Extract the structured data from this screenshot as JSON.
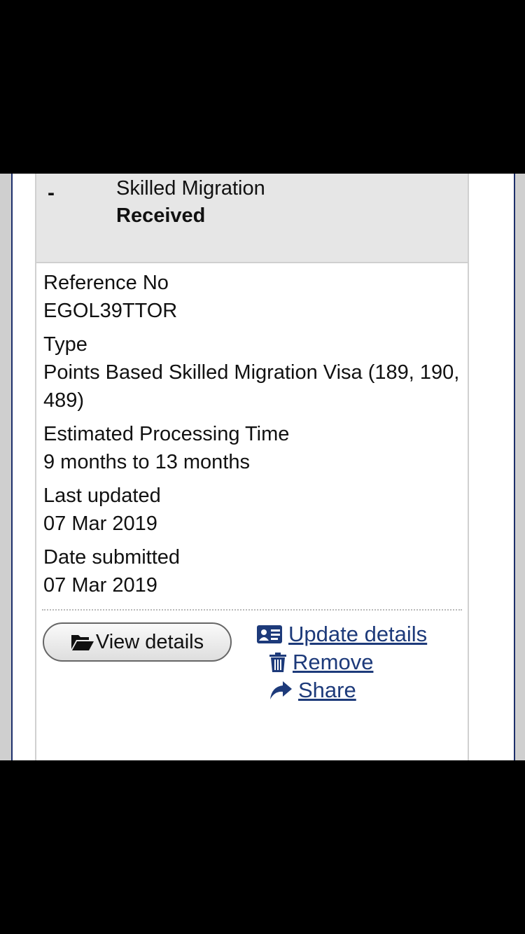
{
  "application": {
    "title": "Skilled Migration",
    "status": "Received",
    "collapse_symbol": "-"
  },
  "fields": [
    {
      "label": "Reference No",
      "value": "EGOL39TTOR"
    },
    {
      "label": "Type",
      "value": "Points Based Skilled Migration Visa (189, 190, 489)"
    },
    {
      "label": "Estimated Processing Time",
      "value": "9 months to 13 months"
    },
    {
      "label": "Last updated",
      "value": "07 Mar 2019"
    },
    {
      "label": "Date submitted",
      "value": "07 Mar 2019"
    }
  ],
  "actions": {
    "view_details": {
      "label": "View details",
      "icon": "folder-open-icon"
    },
    "update_details": {
      "label": "Update details",
      "icon": "id-card-icon"
    },
    "remove": {
      "label": "Remove",
      "icon": "trash-icon"
    },
    "share": {
      "label": "Share",
      "icon": "share-arrow-icon"
    }
  },
  "colors": {
    "link": "#1d3a7a",
    "header_bg": "#e6e6e6",
    "frame_border": "#1d2f6b"
  }
}
